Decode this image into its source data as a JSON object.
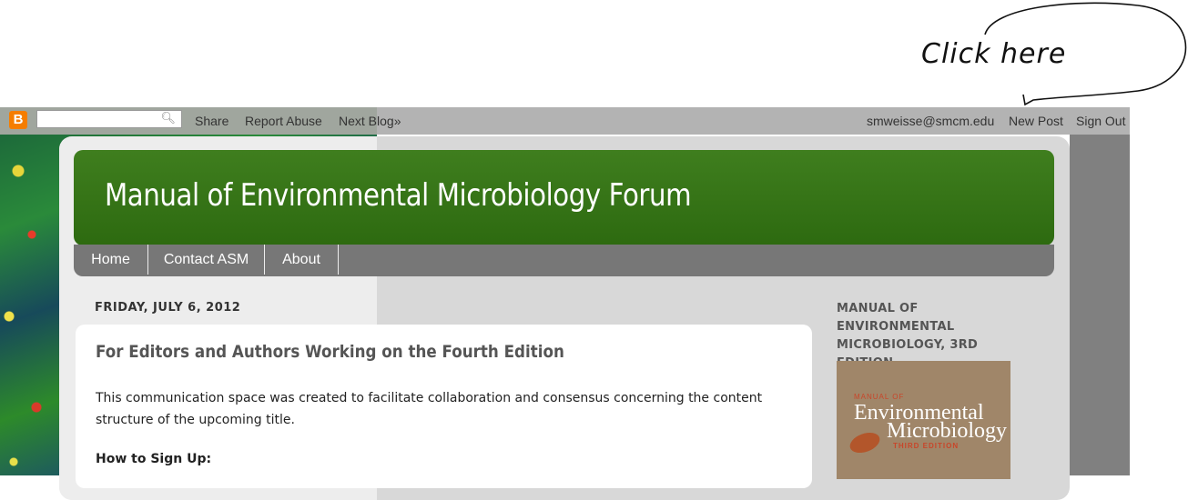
{
  "annotation": {
    "text": "Click here"
  },
  "navbar": {
    "search_value": "",
    "links_left": [
      "Share",
      "Report Abuse",
      "Next Blog»"
    ],
    "email": "smweisse@smcm.edu",
    "new_post": "New Post",
    "sign_out": "Sign Out"
  },
  "blog": {
    "title": "Manual of Environmental Microbiology Forum",
    "tabs": [
      "Home",
      "Contact ASM",
      "About"
    ]
  },
  "post": {
    "date": "FRIDAY, JULY 6, 2012",
    "title": "For Editors and Authors Working on the Fourth Edition",
    "body": "This communication space was created to facilitate collaboration and consensus concerning the content structure of the upcoming title.",
    "subheading": "How to Sign Up:"
  },
  "sidebar": {
    "heading": "MANUAL OF ENVIRONMENTAL MICROBIOLOGY, 3RD EDITION",
    "book": {
      "line1": "MANUAL OF",
      "line2": "Environmental",
      "line3": "Microbiology",
      "line4": "THIRD EDITION"
    }
  }
}
